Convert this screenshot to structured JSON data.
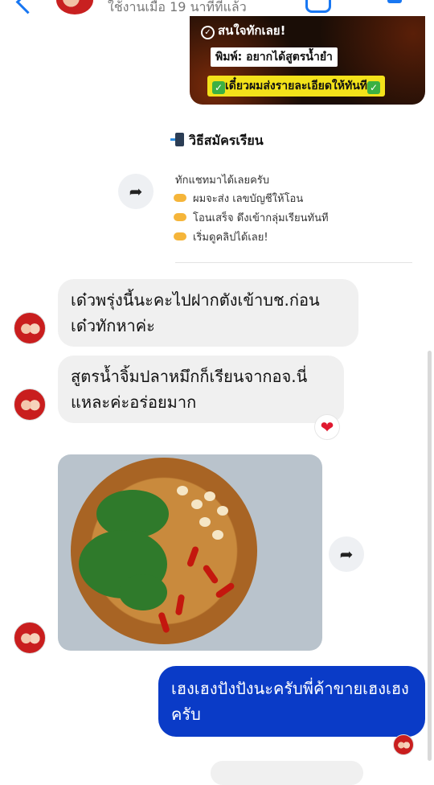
{
  "header": {
    "status": "ใช้งานเมื่อ 19 นาทีที่แล้ว"
  },
  "promo": {
    "line1": "สนใจทักเลย!",
    "line2": "พิมพ์: อยากได้สูตรน้ำยำ",
    "line3": "เดี๋ยวผมส่งรายละเอียดให้ทันที"
  },
  "register": {
    "title": "วิธีสมัครเรียน",
    "intro": "ทักแชทมาได้เลยครับ",
    "steps": [
      "ผมจะส่ง เลขบัญชีให้โอน",
      "โอนเสร็จ ดึงเข้ากลุ่มเรียนทันที",
      "เริ่มดูคลิปได้เลย!"
    ]
  },
  "messages": {
    "m1": "เด๋วพรุ่งนี้นะคะไปฝากตังเข้าบช.ก่อน เด๋วทักหาค่ะ",
    "m2": "สูตรน้ำจิ้มปลาหมึกก็เรียนจากอจ.นี่ แหละค่ะอร่อยมาก",
    "m3": "เฮงเฮงปังปังนะครับพี่ค้าขายเฮงเฮงครับ"
  },
  "reaction": "❤",
  "colors": {
    "accent": "#1877f2",
    "outgoing": "#0a3bc7",
    "incoming": "#f0f0f0"
  },
  "icons": [
    "back-icon",
    "phone-icon",
    "video-icon",
    "forward-icon",
    "heart-icon"
  ]
}
